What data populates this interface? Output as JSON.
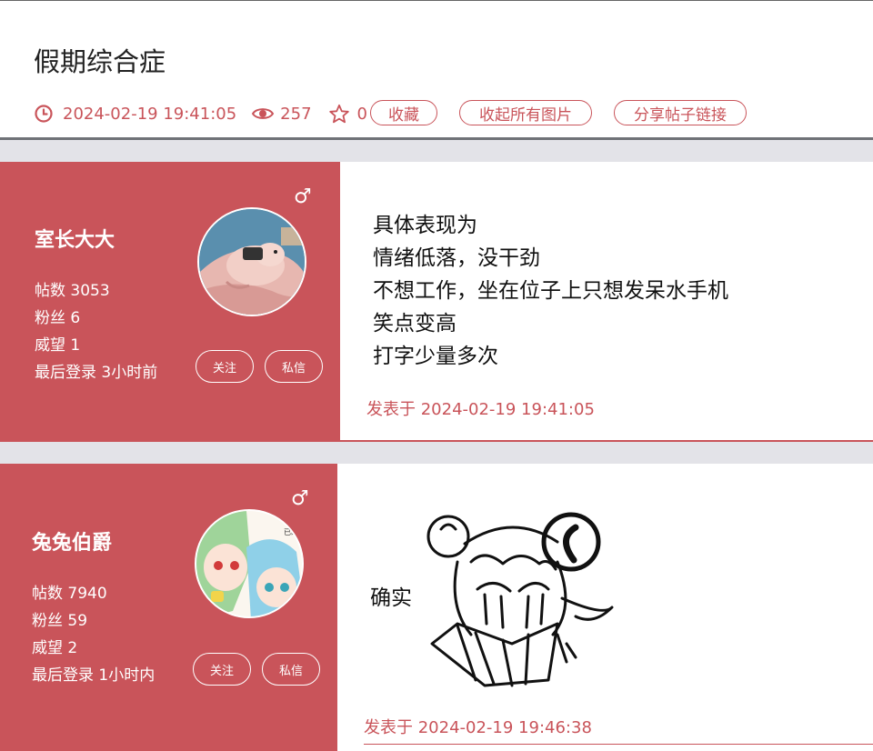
{
  "thread": {
    "title": "假期综合症",
    "time": "2024-02-19 19:41:05",
    "views": "257",
    "stars": "0",
    "buttons": {
      "favorite": "收藏",
      "collapse_images": "收起所有图片",
      "share_link": "分享帖子链接"
    }
  },
  "posts": [
    {
      "username": "室长大大",
      "gender": "♂",
      "posts_label": "帖数 3053",
      "fans_label": "粉丝 6",
      "prestige_label": "威望 1",
      "last_login": "最后登录 3小时前",
      "follow": "关注",
      "message": "私信",
      "lines": [
        "具体表现为",
        "情绪低落，没干劲",
        "不想工作，坐在位子上只想发呆水手机",
        "笑点变高",
        "打字少量多次"
      ],
      "posted_at": "发表于 2024-02-19 19:41:05"
    },
    {
      "username": "兔兔伯爵",
      "gender": "♂",
      "posts_label": "帖数 7940",
      "fans_label": "粉丝 59",
      "prestige_label": "威望 2",
      "last_login": "最后登录 1小时内",
      "follow": "关注",
      "message": "私信",
      "text": "确实",
      "avatar_text": "已经新年",
      "posted_at": "发表于 2024-02-19 19:46:38"
    }
  ],
  "colors": {
    "accent": "#c9545a",
    "divider": "#e3e3e8"
  },
  "icons": [
    "clock-icon",
    "eye-icon",
    "star-icon",
    "male-icon"
  ]
}
